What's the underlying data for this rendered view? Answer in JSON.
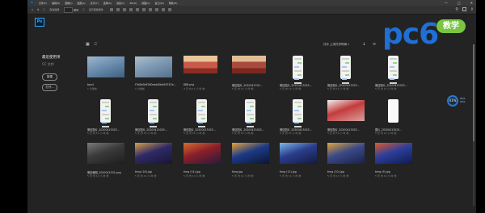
{
  "menubar": {
    "app_abbr": "Ps",
    "items": [
      "文件(F)",
      "编辑(E)",
      "图像(I)",
      "图层(L)",
      "文字(Y)",
      "选择(S)",
      "滤镜(T)",
      "3D(D)",
      "视图(V)",
      "窗口(W)",
      "帮助(H)"
    ],
    "window_controls": [
      "—",
      "□",
      "✕"
    ]
  },
  "options": {
    "auto_select_label": "自动选择:",
    "layer_value": "图层",
    "transform_label": "显示变换控件"
  },
  "sidebar": {
    "title": "最近使用项",
    "subtitle": "CC 文件",
    "new_button": "新建",
    "open_button": "打开..."
  },
  "sort": {
    "label": "排序",
    "value": "上次打开时间"
  },
  "files": [
    {
      "name": "bpx4",
      "meta": "1 分钟前",
      "kind": "photo",
      "colors": [
        "#6d8fb0",
        "#9fb8cc",
        "#3e5f7e"
      ]
    },
    {
      "name": "f7b8b0b9280eadd0bd56742b...",
      "meta": "1 分钟前",
      "kind": "photo",
      "colors": [
        "#7d99b2",
        "#aebfcc",
        "#55708c"
      ]
    },
    {
      "name": "888.png",
      "meta": "4 天 内 11 小 时 前",
      "kind": "banner",
      "colors": [
        "#c95a4a",
        "#e7c59a",
        "#8a2d24"
      ]
    },
    {
      "name": "微信图片_2020041302...",
      "meta": "5 天 内 12 小 时 前",
      "kind": "banner",
      "colors": [
        "#a94a3c",
        "#e1bd95",
        "#7a2820"
      ]
    },
    {
      "name": "微信图片_20200413025...",
      "meta": "5 天 内 12 小 时 前",
      "kind": "phone",
      "colors": []
    },
    {
      "name": "微信图片_20200413025...",
      "meta": "5 天 内 12 小 时 前",
      "kind": "phone",
      "colors": []
    },
    {
      "name": "微信图片_20200413025...",
      "meta": "5 天 内 12 小 时 前",
      "kind": "phone",
      "colors": []
    },
    {
      "name": "微信图片_20200413025...",
      "meta": "5 天 内 12 小 时 前",
      "kind": "phone",
      "colors": []
    },
    {
      "name": "微信图片_20200413025...",
      "meta": "5 天 内 12 小 时 前",
      "kind": "phone",
      "colors": []
    },
    {
      "name": "微信图片_20200413025...",
      "meta": "5 天 内 12 小 时 前",
      "kind": "phone",
      "colors": []
    },
    {
      "name": "微信图片_20200413025...",
      "meta": "5 天 内 12 小 时 前",
      "kind": "phone",
      "colors": []
    },
    {
      "name": "微信图片_20200413025...",
      "meta": "5 天 内 12 小 时 前",
      "kind": "phone",
      "colors": []
    },
    {
      "name": "微信图片_20200413025...",
      "meta": "5 天 内 12 小 时 前",
      "kind": "photo",
      "colors": [
        "#c43b3b",
        "#f0f0f0",
        "#d9a0a0"
      ]
    },
    {
      "name": "图片_20200413025...",
      "meta": "5 天 内 12 小 时 前",
      "kind": "white",
      "colors": []
    },
    {
      "name": "微信截图_2020041302.png",
      "meta": "5 天 内 12 小 时 前",
      "kind": "photo",
      "colors": [
        "#3a3a3a",
        "#7a7a7a",
        "#1e1e1e"
      ]
    },
    {
      "name": "timg (16).jpg",
      "meta": "5 天 内 12 小 时 前",
      "kind": "photo",
      "colors": [
        "#2e2a66",
        "#d8a046",
        "#181636"
      ]
    },
    {
      "name": "timg (14).jpg",
      "meta": "5 天 内 12 小 时 前",
      "kind": "photo",
      "colors": [
        "#8a1f2a",
        "#d96b2e",
        "#2a1a3a"
      ]
    },
    {
      "name": "timg.jpg",
      "meta": "5 天 内 12 小 时 前",
      "kind": "photo",
      "colors": [
        "#1c3b86",
        "#e9a03a",
        "#0c1430"
      ]
    },
    {
      "name": "timg (12).jpg",
      "meta": "5 天 内 12 小 时 前",
      "kind": "photo",
      "colors": [
        "#2b3e8c",
        "#7ab7e8",
        "#121a40"
      ]
    },
    {
      "name": "timg (10).jpg",
      "meta": "5 天 内 12 小 时 前",
      "kind": "photo",
      "colors": [
        "#3b4a88",
        "#e2a33a",
        "#1a2048"
      ]
    },
    {
      "name": "timg (9).jpg",
      "meta": "5 天 内 12 小 时 前",
      "kind": "photo",
      "colors": [
        "#2c3f9a",
        "#e25a2a",
        "#101a52"
      ]
    }
  ],
  "brand": {
    "name": "pc6",
    "tag": "教学"
  },
  "gauge": {
    "value": "41%",
    "up": "0K/s",
    "down": "0K/s"
  }
}
